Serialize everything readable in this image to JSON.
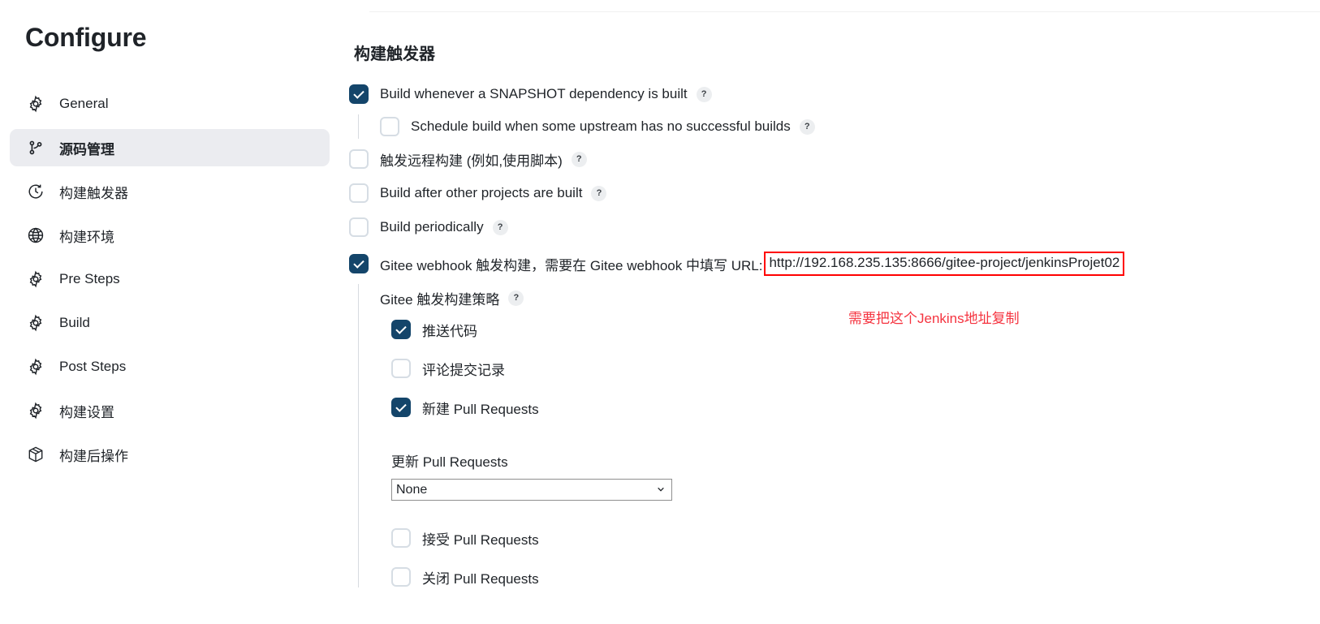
{
  "sidebar": {
    "title": "Configure",
    "items": [
      {
        "label": "General",
        "icon": "gear-icon",
        "active": false
      },
      {
        "label": "源码管理",
        "icon": "git-branch-icon",
        "active": true
      },
      {
        "label": "构建触发器",
        "icon": "clock-icon",
        "active": false
      },
      {
        "label": "构建环境",
        "icon": "globe-icon",
        "active": false
      },
      {
        "label": "Pre Steps",
        "icon": "gear-icon",
        "active": false
      },
      {
        "label": "Build",
        "icon": "gear-icon",
        "active": false
      },
      {
        "label": "Post Steps",
        "icon": "gear-icon",
        "active": false
      },
      {
        "label": "构建设置",
        "icon": "gear-icon",
        "active": false
      },
      {
        "label": "构建后操作",
        "icon": "package-icon",
        "active": false
      }
    ]
  },
  "main": {
    "section_title": "构建触发器",
    "help_glyph": "?",
    "triggers": [
      {
        "label": "Build whenever a SNAPSHOT dependency is built",
        "checked": true,
        "help": true
      },
      {
        "label": "Schedule build when some upstream has no successful builds",
        "checked": false,
        "help": true
      },
      {
        "label": "触发远程构建 (例如,使用脚本)",
        "checked": false,
        "help": true
      },
      {
        "label": "Build after other projects are built",
        "checked": false,
        "help": true
      },
      {
        "label": "Build periodically",
        "checked": false,
        "help": true
      }
    ],
    "gitee": {
      "checked": true,
      "label_prefix": "Gitee webhook 触发构建，需要在 Gitee webhook 中填写 URL:",
      "url": "http://192.168.235.135:8666/gitee-project/jenkinsProjet02",
      "strategy_label": "Gitee 触发构建策略",
      "strategy_items": [
        {
          "label": "推送代码",
          "checked": true
        },
        {
          "label": "评论提交记录",
          "checked": false
        },
        {
          "label": "新建 Pull Requests",
          "checked": true
        }
      ],
      "update_pr_label": "更新 Pull Requests",
      "update_pr_value": "None",
      "update_pr_options": [
        "None"
      ],
      "after_items": [
        {
          "label": "接受 Pull Requests",
          "checked": false
        },
        {
          "label": "关闭 Pull Requests",
          "checked": false
        }
      ]
    },
    "annotation": "需要把这个Jenkins地址复制"
  },
  "colors": {
    "checkbox_checked": "#14456a",
    "sidebar_active_bg": "#ebecf0",
    "annotation_red": "#f5333f",
    "highlight_border": "#ff0000"
  }
}
